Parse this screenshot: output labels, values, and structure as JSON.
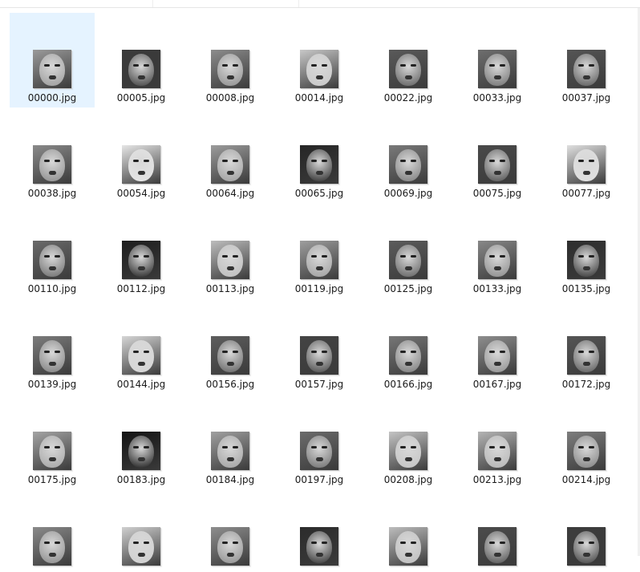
{
  "files": [
    {
      "name": "00000.jpg",
      "tone": "#9a9a9a",
      "selected": true
    },
    {
      "name": "00005.jpg",
      "tone": "#3a3a3a"
    },
    {
      "name": "00008.jpg",
      "tone": "#8c8c8c"
    },
    {
      "name": "00014.jpg",
      "tone": "#c8c8c8"
    },
    {
      "name": "00022.jpg",
      "tone": "#5a5a5a"
    },
    {
      "name": "00033.jpg",
      "tone": "#6e6e6e"
    },
    {
      "name": "00037.jpg",
      "tone": "#555555"
    },
    {
      "name": "00038.jpg",
      "tone": "#8a8a8a"
    },
    {
      "name": "00054.jpg",
      "tone": "#e6e6e6"
    },
    {
      "name": "00064.jpg",
      "tone": "#9c9c9c"
    },
    {
      "name": "00065.jpg",
      "tone": "#262626"
    },
    {
      "name": "00069.jpg",
      "tone": "#7a7a7a"
    },
    {
      "name": "00075.jpg",
      "tone": "#4a4a4a"
    },
    {
      "name": "00077.jpg",
      "tone": "#e0e0e0"
    },
    {
      "name": "00110.jpg",
      "tone": "#6a6a6a"
    },
    {
      "name": "00112.jpg",
      "tone": "#1e1e1e"
    },
    {
      "name": "00113.jpg",
      "tone": "#bdbdbd"
    },
    {
      "name": "00119.jpg",
      "tone": "#9e9e9e"
    },
    {
      "name": "00125.jpg",
      "tone": "#5c5c5c"
    },
    {
      "name": "00133.jpg",
      "tone": "#888888"
    },
    {
      "name": "00135.jpg",
      "tone": "#2e2e2e"
    },
    {
      "name": "00139.jpg",
      "tone": "#7c7c7c"
    },
    {
      "name": "00144.jpg",
      "tone": "#d6d6d6"
    },
    {
      "name": "00156.jpg",
      "tone": "#5e5e5e"
    },
    {
      "name": "00157.jpg",
      "tone": "#444444"
    },
    {
      "name": "00166.jpg",
      "tone": "#777777"
    },
    {
      "name": "00167.jpg",
      "tone": "#8e8e8e"
    },
    {
      "name": "00172.jpg",
      "tone": "#555555"
    },
    {
      "name": "00175.jpg",
      "tone": "#a4a4a4"
    },
    {
      "name": "00183.jpg",
      "tone": "#141414"
    },
    {
      "name": "00184.jpg",
      "tone": "#a0a0a0"
    },
    {
      "name": "00197.jpg",
      "tone": "#6c6c6c"
    },
    {
      "name": "00208.jpg",
      "tone": "#c4c4c4"
    },
    {
      "name": "00213.jpg",
      "tone": "#b4b4b4"
    },
    {
      "name": "00214.jpg",
      "tone": "#7e7e7e"
    },
    {
      "name": "",
      "tone": "#8a8a8a"
    },
    {
      "name": "",
      "tone": "#d0d0d0"
    },
    {
      "name": "",
      "tone": "#8e8e8e"
    },
    {
      "name": "",
      "tone": "#2c2c2c"
    },
    {
      "name": "",
      "tone": "#bdbdbd"
    },
    {
      "name": "",
      "tone": "#4c4c4c"
    },
    {
      "name": "",
      "tone": "#3c3c3c"
    }
  ]
}
